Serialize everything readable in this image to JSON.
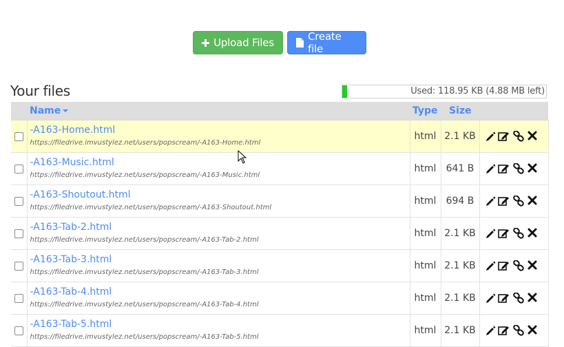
{
  "toolbar": {
    "upload_label": "Upload Files",
    "create_label": "Create file"
  },
  "files_section": {
    "title": "Your files",
    "usage_text": "Used: 118.95 KB (4.88 MB left)",
    "usage_fraction": 0.024
  },
  "table": {
    "headers": {
      "name": "Name",
      "type": "Type",
      "size": "Size"
    },
    "rows": [
      {
        "name": "-A163-Home.html",
        "url": "https://filedrive.imvustylez.net/users/popscream/-A163-Home.html",
        "type": "html",
        "size": "2.1 KB"
      },
      {
        "name": "-A163-Music.html",
        "url": "https://filedrive.imvustylez.net/users/popscream/-A163-Music.html",
        "type": "html",
        "size": "641 B"
      },
      {
        "name": "-A163-Shoutout.html",
        "url": "https://filedrive.imvustylez.net/users/popscream/-A163-Shoutout.html",
        "type": "html",
        "size": "694 B"
      },
      {
        "name": "-A163-Tab-2.html",
        "url": "https://filedrive.imvustylez.net/users/popscream/-A163-Tab-2.html",
        "type": "html",
        "size": "2.1 KB"
      },
      {
        "name": "-A163-Tab-3.html",
        "url": "https://filedrive.imvustylez.net/users/popscream/-A163-Tab-3.html",
        "type": "html",
        "size": "2.1 KB"
      },
      {
        "name": "-A163-Tab-4.html",
        "url": "https://filedrive.imvustylez.net/users/popscream/-A163-Tab-4.html",
        "type": "html",
        "size": "2.1 KB"
      },
      {
        "name": "-A163-Tab-5.html",
        "url": "https://filedrive.imvustylez.net/users/popscream/-A163-Tab-5.html",
        "type": "html",
        "size": "2.1 KB"
      }
    ]
  },
  "colors": {
    "upload_button": "#5cb85c",
    "create_button": "#4e8cf7",
    "link": "#4e8cf7",
    "highlight_row": "#ffffcc",
    "usage_bar": "#22cc22"
  },
  "icons": [
    "plus-icon",
    "file-icon",
    "caret-down-icon",
    "pencil-icon",
    "edit-icon",
    "link-icon",
    "delete-icon"
  ]
}
